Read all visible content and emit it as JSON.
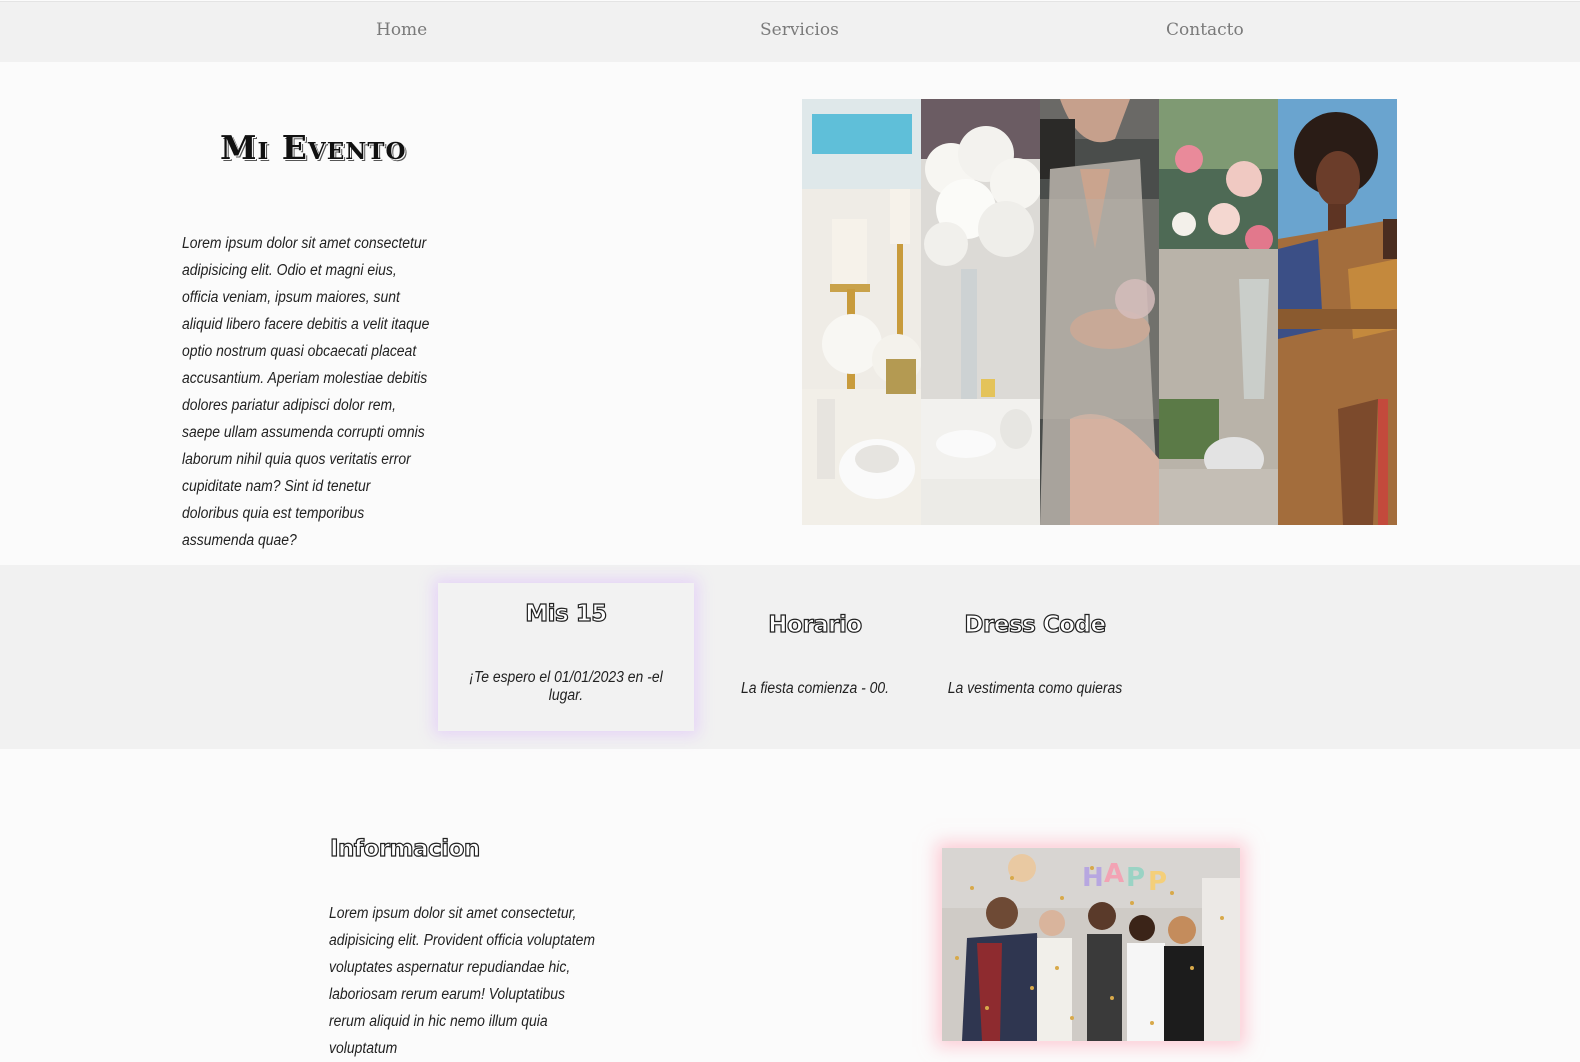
{
  "nav": {
    "home": "Home",
    "services": "Servicios",
    "contact": "Contacto"
  },
  "hero": {
    "title": "Mi Evento",
    "description": "Lorem ipsum dolor sit amet consectetur adipisicing elit. Odio et magni eius, officia veniam, ipsum maiores, sunt aliquid libero facere debitis a velit itaque optio nostrum quasi obcaecati placeat accusantium. Aperiam molestiae debitis dolores pariatur adipisci dolor rem, saepe ullam assumenda corrupti omnis laborum nihil quia quos veritatis error cupiditate nam? Sint id tenetur doloribus quia est temporibus assumenda quae?",
    "gallery": [
      "table-setting-photo",
      "white-flowers-photo",
      "sequin-dress-photo",
      "rose-centerpiece-photo",
      "smiling-woman-photo"
    ]
  },
  "features": [
    {
      "title": "Mis 15",
      "text": "¡Te espero el 01/01/2023 en -el lugar."
    },
    {
      "title": "Horario",
      "text": "La fiesta comienza - 00."
    },
    {
      "title": "Dress Code",
      "text": "La vestimenta como quieras"
    }
  ],
  "info": {
    "title": "Informacion",
    "description": "Lorem ipsum dolor sit amet consectetur, adipisicing elit. Provident officia voluptatem voluptates aspernatur repudiandae hic, laboriosam rerum earum! Voluptatibus rerum aliquid in hic nemo illum quia voluptatum",
    "photo": "party-celebration-photo"
  },
  "colors": {
    "nav_bg": "#f1f1f1",
    "page_bg": "#fbfbfb",
    "card_glow": "#d6b0ff",
    "photo_glow": "#ffaab9"
  }
}
